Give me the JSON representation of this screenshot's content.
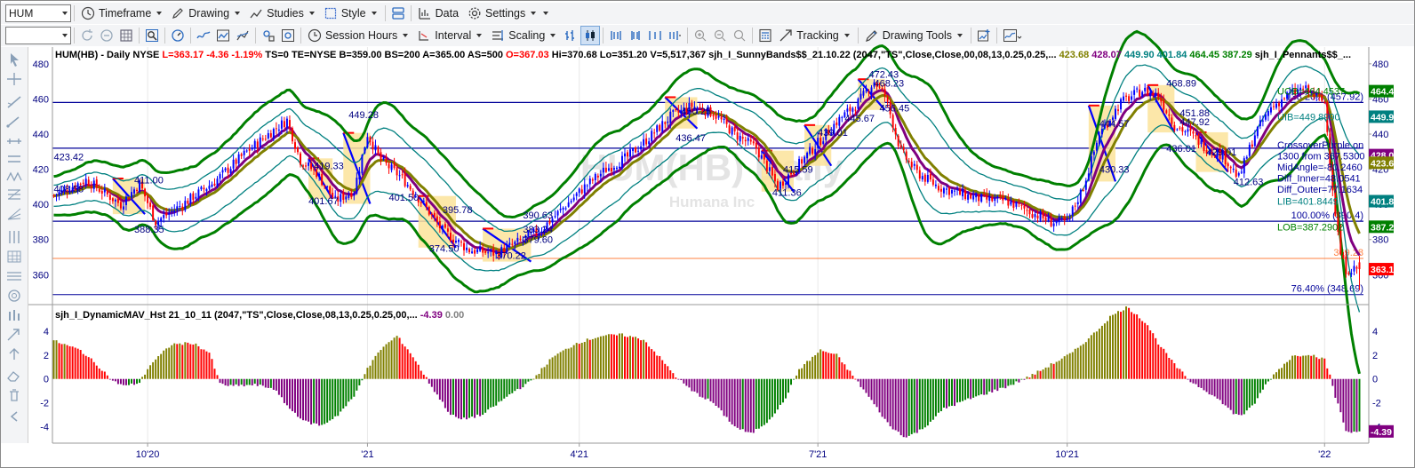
{
  "toolbar1": {
    "symbol": "HUM",
    "timeframe": "Timeframe",
    "drawing": "Drawing",
    "studies": "Studies",
    "style": "Style",
    "data": "Data",
    "settings": "Settings"
  },
  "toolbar2": {
    "session_hours": "Session Hours",
    "interval": "Interval",
    "scaling": "Scaling",
    "tracking": "Tracking",
    "drawing_tools": "Drawing Tools"
  },
  "colors": {
    "up_bar": "#0000ff",
    "down_bar": "#ff0000",
    "outer_band": "#008000",
    "inner_band": "#008080",
    "mid_line": "#800080",
    "mav_line": "#808000",
    "hline": "#000099",
    "fib_line": "#ff8040",
    "hist_red": "#ff0000",
    "hist_olive": "#808000",
    "hist_purple": "#800080",
    "hist_green": "#008000"
  },
  "price_panel": {
    "header_parts": [
      {
        "t": "HUM(HB) - Daily  NYSE  ",
        "c": "#000000"
      },
      {
        "t": "L=363.17  -4.36  -1.19%  ",
        "c": "#ff0000"
      },
      {
        "t": "TS=0  TE=NYSE  B=359.00  BS=200  A=365.00  AS=500  ",
        "c": "#000000"
      },
      {
        "t": "O=367.03  ",
        "c": "#ff0000"
      },
      {
        "t": "Hi=370.68  Lo=351.20  V=5,517,367  sjh_I_SunnyBands$$_21.10.22 (2047,\"TS\",Close,Close,00,08,13,0.25,0.25,...   ",
        "c": "#000000"
      },
      {
        "t": "423.68  ",
        "c": "#808000"
      },
      {
        "t": "428.07  ",
        "c": "#800080"
      },
      {
        "t": "449.90  ",
        "c": "#008080"
      },
      {
        "t": "401.84  ",
        "c": "#008080"
      },
      {
        "t": "464.45  ",
        "c": "#008000"
      },
      {
        "t": "387.29  ",
        "c": "#008000"
      },
      {
        "t": "sjh_I_Pennants$$_...",
        "c": "#000000"
      }
    ],
    "watermark_symbol": "HUM(HB) Daily",
    "watermark_company": "Humana Inc",
    "y_ticks": [
      {
        "v": 480,
        "l": "480"
      },
      {
        "v": 460,
        "l": "460"
      },
      {
        "v": 440,
        "l": "440"
      },
      {
        "v": 420,
        "l": "420"
      },
      {
        "v": 400,
        "l": "400"
      },
      {
        "v": 380,
        "l": "380"
      },
      {
        "v": 360,
        "l": "360"
      }
    ],
    "right_tags": [
      {
        "v": 464.45,
        "l": "464.4",
        "bg": "#008000"
      },
      {
        "v": 449.9,
        "l": "449.9",
        "bg": "#008080"
      },
      {
        "v": 428.07,
        "l": "428.0",
        "bg": "#800080"
      },
      {
        "v": 423.68,
        "l": "423.6",
        "bg": "#808000"
      },
      {
        "v": 401.84,
        "l": "401.8",
        "bg": "#008080"
      },
      {
        "v": 387.29,
        "l": "387.2",
        "bg": "#008000"
      },
      {
        "v": 363.17,
        "l": "363.1",
        "bg": "#ff0000"
      }
    ],
    "hlines": [
      458,
      432,
      390.4
    ],
    "fib_lines": [
      {
        "v": 369.28,
        "l": "369.28",
        "c": "#ff8040"
      },
      {
        "v": 348.69,
        "l": "76.40% (348.69)",
        "c": "#000099"
      }
    ],
    "fib_labels": [
      {
        "v": 457.92,
        "l": "138.20% (457.92)"
      },
      {
        "v": 390.4,
        "l": "100.00% (390.4)"
      }
    ],
    "readouts": [
      {
        "v": 464.4537,
        "l": "UOB=464.4537",
        "c": "#008000"
      },
      {
        "v": 449.899,
        "l": "UIB=449.8990",
        "c": "#008080"
      },
      {
        "v": 401.8449,
        "l": "LIB=401.8449",
        "c": "#008080"
      },
      {
        "v": 387.2902,
        "l": "LOB=387.2902",
        "c": "#008000"
      }
    ],
    "info_box": [
      {
        "l": "CrossoverPurple on",
        "c": "#000099"
      },
      {
        "l": "1300 from 367.5300",
        "c": "#000099"
      },
      {
        "l": "MidAngle=-80.2460",
        "c": "#000099"
      },
      {
        "l": "Diff_Inner=48.0541",
        "c": "#000099"
      },
      {
        "l": "Diff_Outer=77.1634",
        "c": "#000099"
      }
    ],
    "pivot_labels": [
      {
        "i": 0,
        "v": 425,
        "l": "423.42"
      },
      {
        "i": 0,
        "v": 407,
        "l": "408.58"
      },
      {
        "i": 30,
        "v": 412,
        "l": "411.00"
      },
      {
        "i": 30,
        "v": 384,
        "l": "388.35"
      },
      {
        "i": 110,
        "v": 449,
        "l": "449.28"
      },
      {
        "i": 97,
        "v": 420,
        "l": "419.33"
      },
      {
        "i": 95,
        "v": 400,
        "l": "401.67"
      },
      {
        "i": 125,
        "v": 402,
        "l": "401.50"
      },
      {
        "i": 145,
        "v": 395,
        "l": "395.78"
      },
      {
        "i": 175,
        "v": 384,
        "l": "383.24"
      },
      {
        "i": 175,
        "v": 392,
        "l": "390.63"
      },
      {
        "i": 140,
        "v": 373,
        "l": "374.50"
      },
      {
        "i": 175,
        "v": 378,
        "l": "379.60"
      },
      {
        "i": 165,
        "v": 369,
        "l": "370.22"
      },
      {
        "i": 234,
        "v": 451,
        "l": "450.25"
      },
      {
        "i": 232,
        "v": 436,
        "l": "436.47"
      },
      {
        "i": 272,
        "v": 418,
        "l": "415.59"
      },
      {
        "i": 268,
        "v": 405,
        "l": "411.36"
      },
      {
        "i": 285,
        "v": 439,
        "l": "439.01"
      },
      {
        "i": 295,
        "v": 447,
        "l": "445.67"
      },
      {
        "i": 304,
        "v": 472,
        "l": "472.43"
      },
      {
        "i": 306,
        "v": 467,
        "l": "468.23"
      },
      {
        "i": 308,
        "v": 453,
        "l": "456.45"
      },
      {
        "i": 390,
        "v": 444,
        "l": "444.57"
      },
      {
        "i": 390,
        "v": 418,
        "l": "430.33"
      },
      {
        "i": 415,
        "v": 467,
        "l": "468.89"
      },
      {
        "i": 420,
        "v": 450,
        "l": "451.88"
      },
      {
        "i": 420,
        "v": 445,
        "l": "447.92"
      },
      {
        "i": 415,
        "v": 430,
        "l": "436.01"
      },
      {
        "i": 430,
        "v": 428,
        "l": "429.01"
      },
      {
        "i": 440,
        "v": 411,
        "l": "412.63"
      }
    ],
    "x_labels": [
      {
        "i": 35,
        "l": "10'20"
      },
      {
        "i": 117,
        "l": "'21"
      },
      {
        "i": 196,
        "l": "4'21"
      },
      {
        "i": 285,
        "l": "7'21"
      },
      {
        "i": 378,
        "l": "10'21"
      },
      {
        "i": 474,
        "l": "'22"
      }
    ]
  },
  "indicator_panel": {
    "header": "sjh_I_DynamicMAV_Hst 21_10_11 (2047,\"TS\",Close,Close,08,13,0.25,0.25,00,...",
    "header_val1": "-4.39",
    "header_val2": "0.00",
    "y_ticks": [
      {
        "v": 4,
        "l": "4"
      },
      {
        "v": 2,
        "l": "2"
      },
      {
        "v": 0,
        "l": "0"
      },
      {
        "v": -2,
        "l": "-2"
      },
      {
        "v": -4,
        "l": "-4"
      }
    ],
    "last_tag": {
      "v": -4.39,
      "l": "-4.39",
      "bg": "#800080"
    }
  },
  "chart_data": {
    "type": "candlestick",
    "title": "HUM(HB) - Daily",
    "bars": 488,
    "x_labels": [
      "10'20",
      "'21",
      "4'21",
      "7'21",
      "10'21",
      "'22"
    ],
    "ylim_price": [
      345,
      487
    ],
    "ylim_hist": [
      -5,
      6
    ],
    "last": {
      "open": 367.03,
      "high": 370.68,
      "low": 351.2,
      "close": 363.17
    },
    "close_anchors": [
      [
        0,
        405
      ],
      [
        12,
        414
      ],
      [
        25,
        400
      ],
      [
        32,
        412
      ],
      [
        38,
        390
      ],
      [
        48,
        400
      ],
      [
        60,
        413
      ],
      [
        72,
        430
      ],
      [
        80,
        440
      ],
      [
        87,
        448
      ],
      [
        92,
        425
      ],
      [
        98,
        418
      ],
      [
        105,
        402
      ],
      [
        112,
        408
      ],
      [
        117,
        440
      ],
      [
        122,
        425
      ],
      [
        130,
        415
      ],
      [
        138,
        400
      ],
      [
        145,
        385
      ],
      [
        155,
        374
      ],
      [
        165,
        372
      ],
      [
        175,
        380
      ],
      [
        182,
        386
      ],
      [
        190,
        398
      ],
      [
        198,
        410
      ],
      [
        206,
        420
      ],
      [
        214,
        427
      ],
      [
        222,
        438
      ],
      [
        230,
        450
      ],
      [
        238,
        456
      ],
      [
        246,
        452
      ],
      [
        254,
        440
      ],
      [
        262,
        432
      ],
      [
        270,
        410
      ],
      [
        278,
        423
      ],
      [
        285,
        435
      ],
      [
        292,
        447
      ],
      [
        300,
        458
      ],
      [
        306,
        470
      ],
      [
        310,
        462
      ],
      [
        316,
        430
      ],
      [
        322,
        418
      ],
      [
        330,
        410
      ],
      [
        338,
        406
      ],
      [
        346,
        403
      ],
      [
        355,
        402
      ],
      [
        364,
        396
      ],
      [
        372,
        390
      ],
      [
        378,
        390
      ],
      [
        384,
        410
      ],
      [
        390,
        440
      ],
      [
        398,
        458
      ],
      [
        406,
        465
      ],
      [
        412,
        462
      ],
      [
        418,
        445
      ],
      [
        424,
        440
      ],
      [
        430,
        432
      ],
      [
        436,
        428
      ],
      [
        442,
        415
      ],
      [
        448,
        440
      ],
      [
        454,
        455
      ],
      [
        460,
        462
      ],
      [
        466,
        466
      ],
      [
        470,
        462
      ],
      [
        474,
        458
      ],
      [
        476,
        425
      ],
      [
        478,
        395
      ],
      [
        480,
        372
      ],
      [
        481,
        367
      ],
      [
        482,
        363.17
      ]
    ],
    "hist_anchors": [
      [
        0,
        3.2
      ],
      [
        10,
        2.4
      ],
      [
        18,
        0.8
      ],
      [
        22,
        -0.2
      ],
      [
        27,
        -0.6
      ],
      [
        32,
        -0.3
      ],
      [
        36,
        1.2
      ],
      [
        44,
        2.9
      ],
      [
        52,
        3.0
      ],
      [
        58,
        2.2
      ],
      [
        62,
        -0.4
      ],
      [
        66,
        -0.6
      ],
      [
        75,
        -0.5
      ],
      [
        82,
        -0.8
      ],
      [
        88,
        -2.5
      ],
      [
        94,
        -3.6
      ],
      [
        100,
        -3.9
      ],
      [
        106,
        -3.0
      ],
      [
        112,
        -1.5
      ],
      [
        116,
        0.5
      ],
      [
        122,
        2.5
      ],
      [
        128,
        3.6
      ],
      [
        133,
        2.2
      ],
      [
        138,
        0.4
      ],
      [
        142,
        -1.0
      ],
      [
        148,
        -3.0
      ],
      [
        152,
        -3.4
      ],
      [
        160,
        -3.0
      ],
      [
        166,
        -2.0
      ],
      [
        172,
        -1.0
      ],
      [
        178,
        -0.2
      ],
      [
        186,
        1.8
      ],
      [
        195,
        3.0
      ],
      [
        204,
        3.6
      ],
      [
        212,
        3.7
      ],
      [
        220,
        3.3
      ],
      [
        226,
        1.8
      ],
      [
        232,
        0.2
      ],
      [
        238,
        -1.0
      ],
      [
        246,
        -2.0
      ],
      [
        254,
        -4.0
      ],
      [
        260,
        -4.6
      ],
      [
        266,
        -3.6
      ],
      [
        272,
        -2.0
      ],
      [
        278,
        0.8
      ],
      [
        286,
        2.4
      ],
      [
        292,
        2.0
      ],
      [
        298,
        0.3
      ],
      [
        304,
        -1.5
      ],
      [
        312,
        -4.0
      ],
      [
        318,
        -4.9
      ],
      [
        324,
        -4.2
      ],
      [
        332,
        -2.5
      ],
      [
        340,
        -1.8
      ],
      [
        348,
        -1.2
      ],
      [
        356,
        -0.6
      ],
      [
        364,
        0.2
      ],
      [
        372,
        1.2
      ],
      [
        380,
        2.2
      ],
      [
        388,
        3.8
      ],
      [
        394,
        5.2
      ],
      [
        400,
        6.0
      ],
      [
        404,
        5.4
      ],
      [
        408,
        4.5
      ],
      [
        412,
        3.0
      ],
      [
        418,
        1.2
      ],
      [
        424,
        -0.2
      ],
      [
        430,
        -1.0
      ],
      [
        436,
        -2.0
      ],
      [
        440,
        -2.9
      ],
      [
        444,
        -3.0
      ],
      [
        448,
        -2.0
      ],
      [
        452,
        -0.5
      ],
      [
        456,
        0.6
      ],
      [
        462,
        1.9
      ],
      [
        468,
        2.1
      ],
      [
        472,
        1.8
      ],
      [
        474,
        1.6
      ],
      [
        476,
        0.3
      ],
      [
        478,
        -1.5
      ],
      [
        480,
        -2.8
      ],
      [
        482,
        -4.39
      ]
    ]
  }
}
